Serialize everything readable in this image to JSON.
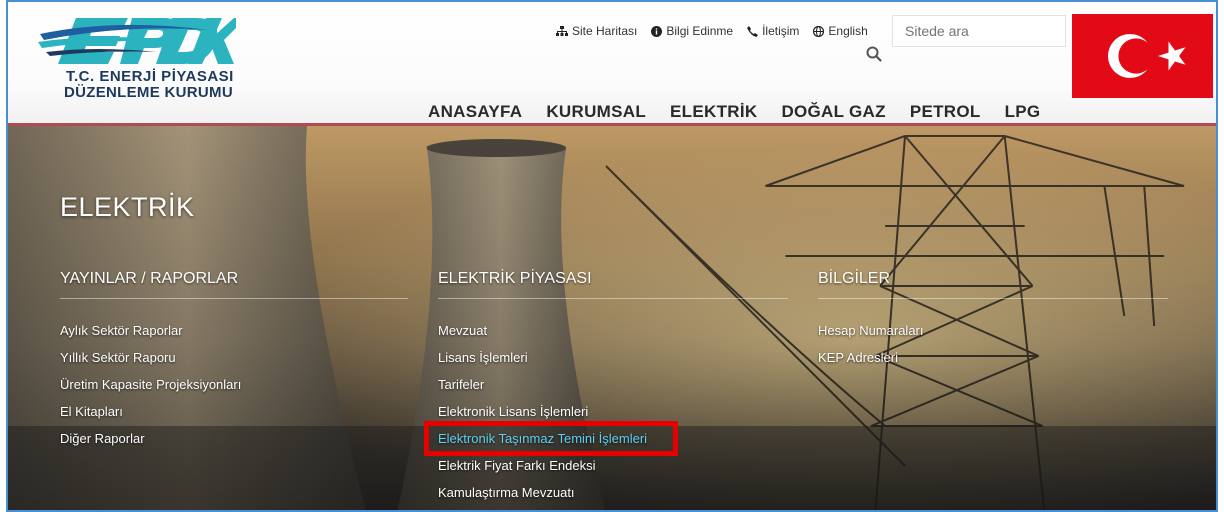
{
  "logo": {
    "line1": "T.C. ENERJİ PİYASASI",
    "line2": "DÜZENLEME KURUMU"
  },
  "utility": [
    {
      "label": "Site Haritası",
      "icon": "sitemap-icon"
    },
    {
      "label": "Bilgi Edinme",
      "icon": "info-icon"
    },
    {
      "label": "İletişim",
      "icon": "phone-icon"
    },
    {
      "label": "English",
      "icon": "globe-icon"
    }
  ],
  "search": {
    "placeholder": "Sitede ara",
    "value": ""
  },
  "nav": [
    "ANASAYFA",
    "KURUMSAL",
    "ELEKTRİK",
    "DOĞAL GAZ",
    "PETROL",
    "LPG"
  ],
  "page_title": "ELEKTRİK",
  "columns": [
    {
      "title": "YAYINLAR / RAPORLAR",
      "items": [
        "Aylık Sektör Raporlar",
        "Yıllık Sektör Raporu",
        "Üretim Kapasite Projeksiyonları",
        "El Kitapları",
        "Diğer Raporlar"
      ]
    },
    {
      "title": "ELEKTRİK PİYASASI",
      "items": [
        "Mevzuat",
        "Lisans İşlemleri",
        "Tarifeler",
        "Elektronik Lisans İşlemleri",
        "Elektronik Taşınmaz Temini İşlemleri",
        "Elektrik Fiyat Farkı Endeksi",
        "Kamulaştırma Mevzuatı"
      ]
    },
    {
      "title": "BİLGİLER",
      "items": [
        "Hesap Numaraları",
        "KEP Adresleri"
      ]
    }
  ],
  "colors": {
    "accent_border": "#4a8fd6",
    "highlight": "#e60000",
    "active_link": "#5fd1f0",
    "flag_red": "#e30a17",
    "logo_teal": "#2bb3c0",
    "logo_navy": "#1d3a5e"
  }
}
